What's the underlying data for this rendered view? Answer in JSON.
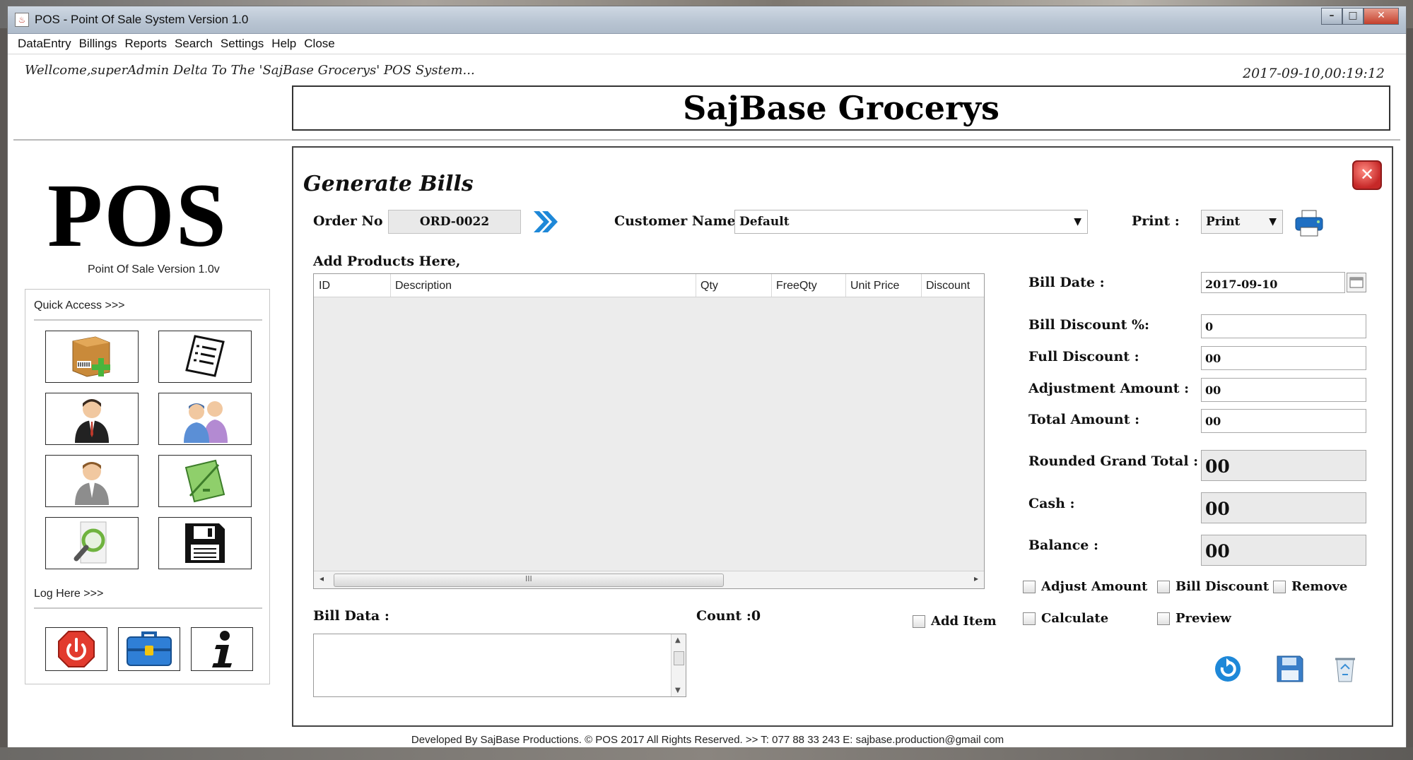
{
  "window": {
    "title": "POS - Point Of Sale System Version 1.0",
    "controls": [
      "–",
      "□",
      "✕"
    ]
  },
  "menu": [
    "DataEntry",
    "Billings",
    "Reports",
    "Search",
    "Settings",
    "Help",
    "Close"
  ],
  "header": {
    "welcome": "Wellcome,superAdmin Delta To The 'SajBase Grocerys'  POS System...",
    "datetime": "2017-09-10,00:19:12",
    "store_name": "SajBase Grocerys"
  },
  "sidebar": {
    "logo": "POS",
    "version": "Point Of Sale Version 1.0v",
    "quick_access_label": "Quick Access >>>",
    "quick_access_icons": [
      "add-product-icon",
      "bill-list-icon",
      "user-icon",
      "customers-icon",
      "employee-icon",
      "notes-icon",
      "search-icon",
      "save-icon"
    ],
    "log_label": "Log Here >>>",
    "log_icons": [
      "power-icon",
      "lock-briefcase-icon",
      "info-icon"
    ]
  },
  "bill": {
    "title": "Generate Bills",
    "order_label": "Order No :",
    "order_no": "ORD-0022",
    "customer_label": "Customer Name :",
    "customer": "Default",
    "print_label": "Print :",
    "print_option": "Print",
    "add_products_label": "Add Products Here,",
    "table": {
      "columns": [
        "ID",
        "Description",
        "Qty",
        "FreeQty",
        "Unit Price",
        "Discount"
      ],
      "rows": [],
      "scroll_grip": "III"
    },
    "bill_data_label": "Bill Data :",
    "count": "Count :0",
    "add_item": "Add Item",
    "fields": {
      "bill_date_label": "Bill Date :",
      "bill_date": "2017-09-10",
      "bill_discount_label": "Bill Discount %:",
      "bill_discount": "0",
      "full_discount_label": "Full Discount :",
      "full_discount": "00",
      "adjustment_label": "Adjustment Amount :",
      "adjustment": "00",
      "total_label": "Total Amount :",
      "total": "00",
      "grand_total_label": "Rounded Grand Total :",
      "grand_total": "00",
      "cash_label": "Cash :",
      "cash": "00",
      "balance_label": "Balance :",
      "balance": "00"
    },
    "checkboxes": {
      "adjust_amount": "Adjust Amount",
      "bill_discount": "Bill Discount",
      "remove": "Remove",
      "calculate": "Calculate",
      "preview": "Preview"
    },
    "actions": [
      "refresh-icon",
      "save-icon",
      "recycle-bin-icon"
    ]
  },
  "footer": "Developed By SajBase Productions. © POS 2017 All Rights Reserved.  >>  T: 077 88 33 243 E: sajbase.production@gmail com",
  "colors": {
    "accent_blue": "#1e88d8",
    "close_red": "#c62828",
    "field_gray": "#eaeaea"
  }
}
